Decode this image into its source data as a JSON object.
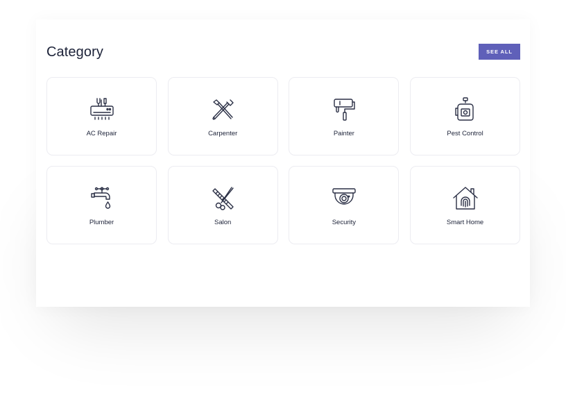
{
  "section": {
    "title": "Category",
    "see_all_label": "SEE ALL"
  },
  "colors": {
    "accent": "#5f60b9",
    "text": "#1c2238",
    "icon_stroke": "#2a2f45",
    "tile_border": "#ececf1"
  },
  "categories": [
    {
      "label": "AC Repair",
      "icon": "ac-repair-icon"
    },
    {
      "label": "Carpenter",
      "icon": "carpenter-icon"
    },
    {
      "label": "Painter",
      "icon": "paint-roller-icon"
    },
    {
      "label": "Pest Control",
      "icon": "pest-spray-icon"
    },
    {
      "label": "Plumber",
      "icon": "faucet-icon"
    },
    {
      "label": "Salon",
      "icon": "scissors-comb-icon"
    },
    {
      "label": "Security",
      "icon": "security-camera-icon"
    },
    {
      "label": "Smart Home",
      "icon": "smart-home-icon"
    }
  ]
}
